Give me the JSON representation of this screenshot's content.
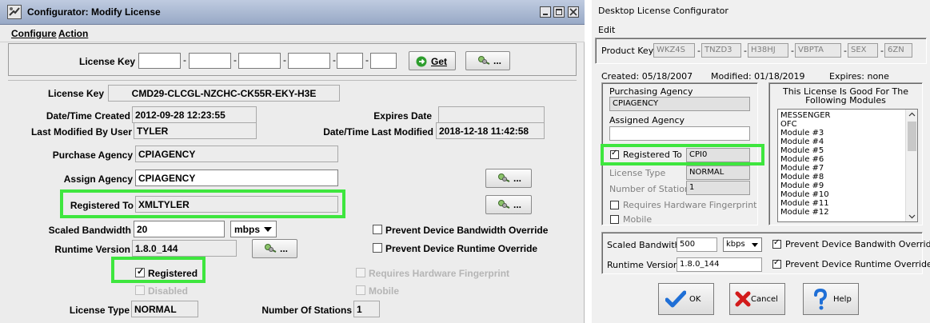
{
  "left": {
    "title": "Configurator: Modify License",
    "menu": {
      "configure": "Configure",
      "action": "Action"
    },
    "license_key_label": "License Key",
    "get_label": "Get",
    "dots": "...",
    "license_key_value": "CMD29-CLCGL-NZCHC-CK55R-EKY-H3E",
    "date_created_label": "Date/Time Created",
    "date_created_value": "2012-09-28 12:23:55",
    "expires_label": "Expires Date",
    "expires_value": "",
    "last_modified_by_label": "Last Modified By User",
    "last_modified_by_value": "TYLER",
    "last_modified_label": "Date/Time Last Modified",
    "last_modified_value": "2018-12-18 11:42:58",
    "purchase_agency_label": "Purchase Agency",
    "purchase_agency_value": "CPIAGENCY",
    "assign_agency_label": "Assign Agency",
    "assign_agency_value": "CPIAGENCY",
    "registered_to_label": "Registered To",
    "registered_to_value": "XMLTYLER",
    "scaled_bandwidth_label": "Scaled Bandwidth",
    "scaled_bandwidth_value": "20",
    "bandwidth_unit": "mbps",
    "prevent_bandwidth_label": "Prevent Device Bandwidth Override",
    "runtime_version_label": "Runtime Version",
    "runtime_version_value": "1.8.0_144",
    "prevent_runtime_label": "Prevent Device Runtime Override",
    "registered_label": "Registered",
    "requires_fingerprint_label": "Requires Hardware Fingerprint",
    "disabled_label": "Disabled",
    "mobile_label": "Mobile",
    "license_type_label": "License Type",
    "license_type_value": "NORMAL",
    "stations_label": "Number Of Stations",
    "stations_value": "1",
    "highlight_color": "#3ee63e"
  },
  "right": {
    "title": "Desktop License Configurator",
    "menu_edit": "Edit",
    "product_key_label": "Product Key:",
    "product_key": [
      "WKZ4S",
      "TNZD3",
      "H38HJ",
      "VBPTA",
      "SEX",
      "6ZN"
    ],
    "key_dash": "-",
    "created": "Created: 05/18/2007",
    "modified": "Modified: 01/18/2019",
    "expires": "Expires: none",
    "purchasing_agency_label": "Purchasing Agency",
    "purchasing_agency_value": "CPIAGENCY",
    "assigned_agency_label": "Assigned Agency",
    "assigned_agency_value": "",
    "registered_to_label": "Registered To",
    "registered_to_value": "CPI0",
    "license_type_label": "License Type",
    "license_type_value": "NORMAL",
    "stations_label": "Number of Stations",
    "stations_value": "1",
    "requires_fingerprint_label": "Requires Hardware Fingerprint",
    "mobile_label": "Mobile",
    "modules_header": "This License Is Good For The Following Modules",
    "modules": [
      "MESSENGER",
      "OFC",
      "Module #3",
      "Module #4",
      "Module #5",
      "Module #6",
      "Module #7",
      "Module #8",
      "Module #9",
      "Module #10",
      "Module #11",
      "Module #12"
    ],
    "scaled_bandwidth_label": "Scaled Bandwith",
    "scaled_bandwidth_value": "500",
    "bandwidth_unit": "kbps",
    "prevent_bandwidth_label": "Prevent Device Bandwith Override",
    "runtime_version_label": "Runtime Version",
    "runtime_version_value": "1.8.0_144",
    "prevent_runtime_label": "Prevent Device Runtime Override",
    "ok_label": "OK",
    "cancel_label": "Cancel",
    "help_label": "Help"
  }
}
